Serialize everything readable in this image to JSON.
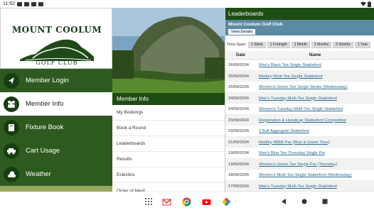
{
  "status": {
    "time": "11:52"
  },
  "logo": {
    "title": "MOUNT COOLUM",
    "subtitle": "GOLF CLUB"
  },
  "menu": [
    {
      "label": "Member Login"
    },
    {
      "label": "Member Info"
    },
    {
      "label": "Fixture Book"
    },
    {
      "label": "Cart Usage"
    },
    {
      "label": "Weather"
    }
  ],
  "member_info": {
    "header": "Member Info",
    "items": [
      "My Bookings",
      "Book a Round",
      "Leaderboards",
      "Results",
      "Eclectics",
      "Order of Merit"
    ]
  },
  "leaderboards": {
    "header": "Leaderboards",
    "course": "Mount Coolum Golf Club",
    "view_details": "View Details",
    "time_span_label": "Time Span:",
    "time_spans": [
      "1 Week",
      "1 Fortnight",
      "1 Month",
      "3 Months",
      "6 Months",
      "1 Year"
    ],
    "col_date": "Date",
    "col_name": "Name",
    "rows": [
      {
        "date": "26/09/2024",
        "name": "Men's Black Tee Single Stableford"
      },
      {
        "date": "25/09/2024",
        "name": "Medley Multi-Tee Single Stableford"
      },
      {
        "date": "25/09/2024",
        "name": "Women's Green Tee Single Stroke (Wednesday)"
      },
      {
        "date": "24/09/2024",
        "name": "Men's Tuesday Multi-Tee Single Stableford"
      },
      {
        "date": "24/09/2024",
        "name": "Women's Tuesday Multi-Tee Single Stableford"
      },
      {
        "date": "23/09/2024",
        "name": "Registration & Handicap Stableford Competition"
      },
      {
        "date": "23/09/2024",
        "name": "2 Ball Aggregate Stableford"
      },
      {
        "date": "21/09/2024",
        "name": "Medley 4BBB Par (Blue & Green Tees)"
      },
      {
        "date": "19/09/2024",
        "name": "Men's Blue Tee Thursday Single Par"
      },
      {
        "date": "19/09/2024",
        "name": "Women's Green Tee Single Par (Thursday)"
      },
      {
        "date": "18/09/2024",
        "name": "Women's Multi-Tee Single Stableford (Wednesday)"
      },
      {
        "date": "17/09/2024",
        "name": "Men's Tuesday Multi-Tee Single Stableford"
      }
    ]
  },
  "colors": {
    "dark_green": "#1d4d12",
    "menu_green": "#2e5a1f",
    "light_olive": "#98a65d",
    "link_blue": "#2c6b92",
    "course_blue": "#5b8aa4"
  }
}
